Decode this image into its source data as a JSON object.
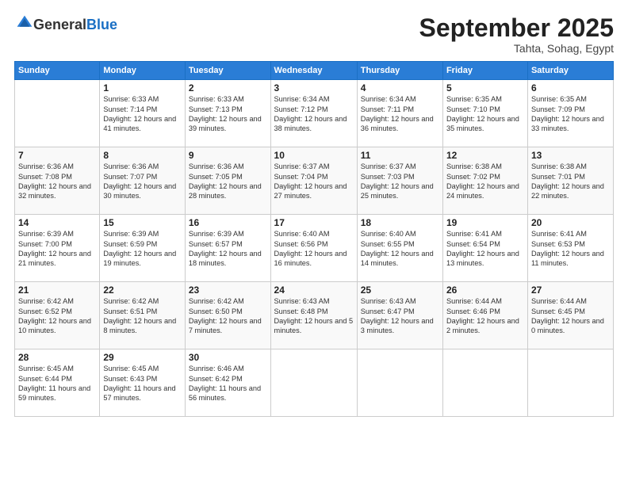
{
  "logo": {
    "general": "General",
    "blue": "Blue"
  },
  "header": {
    "month": "September 2025",
    "location": "Tahta, Sohag, Egypt"
  },
  "columns": [
    "Sunday",
    "Monday",
    "Tuesday",
    "Wednesday",
    "Thursday",
    "Friday",
    "Saturday"
  ],
  "weeks": [
    [
      {
        "day": "",
        "sunrise": "",
        "sunset": "",
        "daylight": ""
      },
      {
        "day": "1",
        "sunrise": "Sunrise: 6:33 AM",
        "sunset": "Sunset: 7:14 PM",
        "daylight": "Daylight: 12 hours and 41 minutes."
      },
      {
        "day": "2",
        "sunrise": "Sunrise: 6:33 AM",
        "sunset": "Sunset: 7:13 PM",
        "daylight": "Daylight: 12 hours and 39 minutes."
      },
      {
        "day": "3",
        "sunrise": "Sunrise: 6:34 AM",
        "sunset": "Sunset: 7:12 PM",
        "daylight": "Daylight: 12 hours and 38 minutes."
      },
      {
        "day": "4",
        "sunrise": "Sunrise: 6:34 AM",
        "sunset": "Sunset: 7:11 PM",
        "daylight": "Daylight: 12 hours and 36 minutes."
      },
      {
        "day": "5",
        "sunrise": "Sunrise: 6:35 AM",
        "sunset": "Sunset: 7:10 PM",
        "daylight": "Daylight: 12 hours and 35 minutes."
      },
      {
        "day": "6",
        "sunrise": "Sunrise: 6:35 AM",
        "sunset": "Sunset: 7:09 PM",
        "daylight": "Daylight: 12 hours and 33 minutes."
      }
    ],
    [
      {
        "day": "7",
        "sunrise": "Sunrise: 6:36 AM",
        "sunset": "Sunset: 7:08 PM",
        "daylight": "Daylight: 12 hours and 32 minutes."
      },
      {
        "day": "8",
        "sunrise": "Sunrise: 6:36 AM",
        "sunset": "Sunset: 7:07 PM",
        "daylight": "Daylight: 12 hours and 30 minutes."
      },
      {
        "day": "9",
        "sunrise": "Sunrise: 6:36 AM",
        "sunset": "Sunset: 7:05 PM",
        "daylight": "Daylight: 12 hours and 28 minutes."
      },
      {
        "day": "10",
        "sunrise": "Sunrise: 6:37 AM",
        "sunset": "Sunset: 7:04 PM",
        "daylight": "Daylight: 12 hours and 27 minutes."
      },
      {
        "day": "11",
        "sunrise": "Sunrise: 6:37 AM",
        "sunset": "Sunset: 7:03 PM",
        "daylight": "Daylight: 12 hours and 25 minutes."
      },
      {
        "day": "12",
        "sunrise": "Sunrise: 6:38 AM",
        "sunset": "Sunset: 7:02 PM",
        "daylight": "Daylight: 12 hours and 24 minutes."
      },
      {
        "day": "13",
        "sunrise": "Sunrise: 6:38 AM",
        "sunset": "Sunset: 7:01 PM",
        "daylight": "Daylight: 12 hours and 22 minutes."
      }
    ],
    [
      {
        "day": "14",
        "sunrise": "Sunrise: 6:39 AM",
        "sunset": "Sunset: 7:00 PM",
        "daylight": "Daylight: 12 hours and 21 minutes."
      },
      {
        "day": "15",
        "sunrise": "Sunrise: 6:39 AM",
        "sunset": "Sunset: 6:59 PM",
        "daylight": "Daylight: 12 hours and 19 minutes."
      },
      {
        "day": "16",
        "sunrise": "Sunrise: 6:39 AM",
        "sunset": "Sunset: 6:57 PM",
        "daylight": "Daylight: 12 hours and 18 minutes."
      },
      {
        "day": "17",
        "sunrise": "Sunrise: 6:40 AM",
        "sunset": "Sunset: 6:56 PM",
        "daylight": "Daylight: 12 hours and 16 minutes."
      },
      {
        "day": "18",
        "sunrise": "Sunrise: 6:40 AM",
        "sunset": "Sunset: 6:55 PM",
        "daylight": "Daylight: 12 hours and 14 minutes."
      },
      {
        "day": "19",
        "sunrise": "Sunrise: 6:41 AM",
        "sunset": "Sunset: 6:54 PM",
        "daylight": "Daylight: 12 hours and 13 minutes."
      },
      {
        "day": "20",
        "sunrise": "Sunrise: 6:41 AM",
        "sunset": "Sunset: 6:53 PM",
        "daylight": "Daylight: 12 hours and 11 minutes."
      }
    ],
    [
      {
        "day": "21",
        "sunrise": "Sunrise: 6:42 AM",
        "sunset": "Sunset: 6:52 PM",
        "daylight": "Daylight: 12 hours and 10 minutes."
      },
      {
        "day": "22",
        "sunrise": "Sunrise: 6:42 AM",
        "sunset": "Sunset: 6:51 PM",
        "daylight": "Daylight: 12 hours and 8 minutes."
      },
      {
        "day": "23",
        "sunrise": "Sunrise: 6:42 AM",
        "sunset": "Sunset: 6:50 PM",
        "daylight": "Daylight: 12 hours and 7 minutes."
      },
      {
        "day": "24",
        "sunrise": "Sunrise: 6:43 AM",
        "sunset": "Sunset: 6:48 PM",
        "daylight": "Daylight: 12 hours and 5 minutes."
      },
      {
        "day": "25",
        "sunrise": "Sunrise: 6:43 AM",
        "sunset": "Sunset: 6:47 PM",
        "daylight": "Daylight: 12 hours and 3 minutes."
      },
      {
        "day": "26",
        "sunrise": "Sunrise: 6:44 AM",
        "sunset": "Sunset: 6:46 PM",
        "daylight": "Daylight: 12 hours and 2 minutes."
      },
      {
        "day": "27",
        "sunrise": "Sunrise: 6:44 AM",
        "sunset": "Sunset: 6:45 PM",
        "daylight": "Daylight: 12 hours and 0 minutes."
      }
    ],
    [
      {
        "day": "28",
        "sunrise": "Sunrise: 6:45 AM",
        "sunset": "Sunset: 6:44 PM",
        "daylight": "Daylight: 11 hours and 59 minutes."
      },
      {
        "day": "29",
        "sunrise": "Sunrise: 6:45 AM",
        "sunset": "Sunset: 6:43 PM",
        "daylight": "Daylight: 11 hours and 57 minutes."
      },
      {
        "day": "30",
        "sunrise": "Sunrise: 6:46 AM",
        "sunset": "Sunset: 6:42 PM",
        "daylight": "Daylight: 11 hours and 56 minutes."
      },
      {
        "day": "",
        "sunrise": "",
        "sunset": "",
        "daylight": ""
      },
      {
        "day": "",
        "sunrise": "",
        "sunset": "",
        "daylight": ""
      },
      {
        "day": "",
        "sunrise": "",
        "sunset": "",
        "daylight": ""
      },
      {
        "day": "",
        "sunrise": "",
        "sunset": "",
        "daylight": ""
      }
    ]
  ]
}
